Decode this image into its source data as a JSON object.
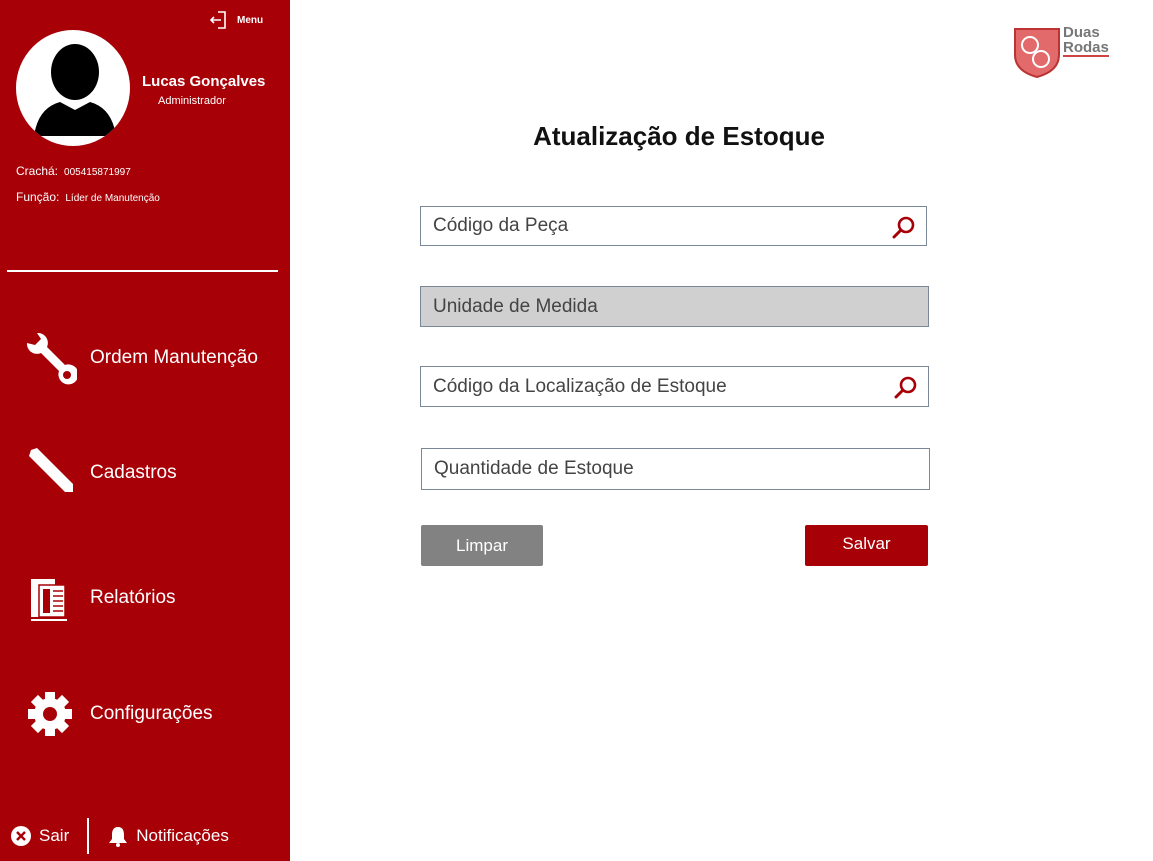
{
  "sidebar": {
    "menu_label": "Menu",
    "user": {
      "name": "Lucas Gonçalves",
      "role": "Administrador"
    },
    "badge": {
      "label": "Crachá:",
      "value": "005415871997"
    },
    "function": {
      "label": "Função:",
      "value": "Líder de Manutenção"
    },
    "nav": [
      {
        "label": "Ordem Manutenção",
        "icon": "wrench-icon"
      },
      {
        "label": "Cadastros",
        "icon": "pencil-icon"
      },
      {
        "label": "Relatórios",
        "icon": "report-icon"
      },
      {
        "label": "Configurações",
        "icon": "gear-icon"
      }
    ],
    "footer": {
      "exit_label": "Sair",
      "notifications_label": "Notificações"
    }
  },
  "brand": {
    "line1": "Duas",
    "line2": "Rodas"
  },
  "main": {
    "title": "Atualização de Estoque",
    "fields": {
      "part_code": {
        "placeholder": "Código da Peça",
        "value": ""
      },
      "unit": {
        "placeholder": "Unidade de Medida",
        "value": ""
      },
      "location_code": {
        "placeholder": "Código da Localização de Estoque",
        "value": ""
      },
      "quantity": {
        "placeholder": "Quantidade de Estoque",
        "value": ""
      }
    },
    "buttons": {
      "clear": "Limpar",
      "save": "Salvar"
    }
  },
  "colors": {
    "primary": "#a70007",
    "disabled": "#d0d0d0",
    "clear_button": "#828282"
  }
}
